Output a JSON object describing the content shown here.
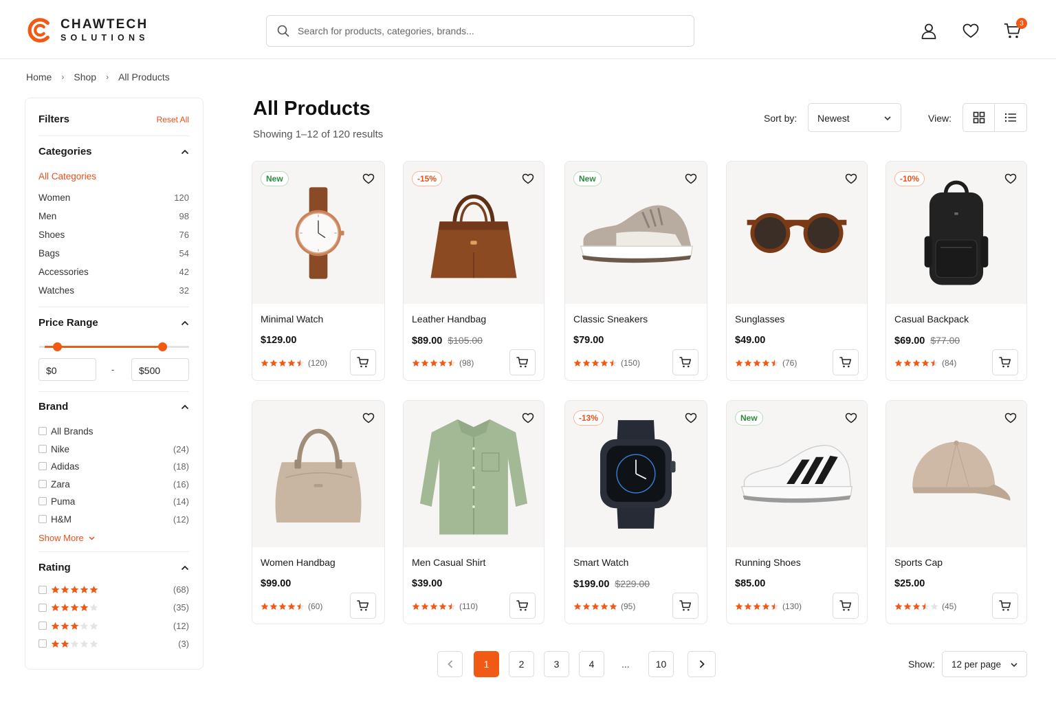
{
  "brand": {
    "line1": "CHAWTECH",
    "line2": "SOLUTIONS",
    "accent": "#f05a14"
  },
  "search": {
    "placeholder": "Search for products, categories, brands..."
  },
  "header": {
    "cart_count": "3",
    "icons": [
      "user-icon",
      "heart-icon",
      "cart-icon"
    ]
  },
  "breadcrumb": [
    "Home",
    "Shop",
    "All Products"
  ],
  "filters": {
    "title": "Filters",
    "reset": "Reset All",
    "categories": {
      "title": "Categories",
      "active": "All Categories",
      "items": [
        {
          "label": "Women",
          "count": "120"
        },
        {
          "label": "Men",
          "count": "98"
        },
        {
          "label": "Shoes",
          "count": "76"
        },
        {
          "label": "Bags",
          "count": "54"
        },
        {
          "label": "Accessories",
          "count": "42"
        },
        {
          "label": "Watches",
          "count": "32"
        }
      ]
    },
    "price": {
      "title": "Price Range",
      "min": "$0",
      "max": "$500",
      "dash": "-"
    },
    "brand": {
      "title": "Brand",
      "items": [
        {
          "label": "All Brands",
          "count": ""
        },
        {
          "label": "Nike",
          "count": "(24)"
        },
        {
          "label": "Adidas",
          "count": "(18)"
        },
        {
          "label": "Zara",
          "count": "(16)"
        },
        {
          "label": "Puma",
          "count": "(14)"
        },
        {
          "label": "H&M",
          "count": "(12)"
        }
      ],
      "show_more": "Show More"
    },
    "rating": {
      "title": "Rating",
      "items": [
        {
          "stars": 5,
          "count": "(68)"
        },
        {
          "stars": 4,
          "count": "(35)"
        },
        {
          "stars": 3,
          "count": "(12)"
        },
        {
          "stars": 2,
          "count": "(3)"
        }
      ]
    }
  },
  "main": {
    "title": "All Products",
    "results": "Showing 1–12 of 120 results",
    "sort_label": "Sort by:",
    "sort_value": "Newest",
    "view_label": "View:"
  },
  "products": [
    {
      "name": "Minimal Watch",
      "price": "$129.00",
      "old": "",
      "badge": "New",
      "badge_type": "new",
      "rating": 4.5,
      "reviews": "(120)",
      "img": "watch"
    },
    {
      "name": "Leather Handbag",
      "price": "$89.00",
      "old": "$105.00",
      "badge": "-15%",
      "badge_type": "sale",
      "rating": 4.5,
      "reviews": "(98)",
      "img": "handbag"
    },
    {
      "name": "Classic Sneakers",
      "price": "$79.00",
      "old": "",
      "badge": "New",
      "badge_type": "new",
      "rating": 4.5,
      "reviews": "(150)",
      "img": "sneaker"
    },
    {
      "name": "Sunglasses",
      "price": "$49.00",
      "old": "",
      "badge": "",
      "badge_type": "",
      "rating": 4.5,
      "reviews": "(76)",
      "img": "sunglasses"
    },
    {
      "name": "Casual Backpack",
      "price": "$69.00",
      "old": "$77.00",
      "badge": "-10%",
      "badge_type": "sale",
      "rating": 4.5,
      "reviews": "(84)",
      "img": "backpack"
    },
    {
      "name": "Women Handbag",
      "price": "$99.00",
      "old": "",
      "badge": "",
      "badge_type": "",
      "rating": 4.5,
      "reviews": "(60)",
      "img": "handbag2"
    },
    {
      "name": "Men Casual Shirt",
      "price": "$39.00",
      "old": "",
      "badge": "",
      "badge_type": "",
      "rating": 4.5,
      "reviews": "(110)",
      "img": "shirt"
    },
    {
      "name": "Smart Watch",
      "price": "$199.00",
      "old": "$229.00",
      "badge": "-13%",
      "badge_type": "sale",
      "rating": 5,
      "reviews": "(95)",
      "img": "smartwatch"
    },
    {
      "name": "Running Shoes",
      "price": "$85.00",
      "old": "",
      "badge": "New",
      "badge_type": "new",
      "rating": 4.5,
      "reviews": "(130)",
      "img": "running"
    },
    {
      "name": "Sports Cap",
      "price": "$25.00",
      "old": "",
      "badge": "",
      "badge_type": "",
      "rating": 3.5,
      "reviews": "(45)",
      "img": "cap"
    }
  ],
  "pagination": {
    "pages": [
      "1",
      "2",
      "3",
      "4",
      "10"
    ],
    "dots": "...",
    "current": "1"
  },
  "per_page": {
    "label": "Show:",
    "value": "12 per page"
  }
}
